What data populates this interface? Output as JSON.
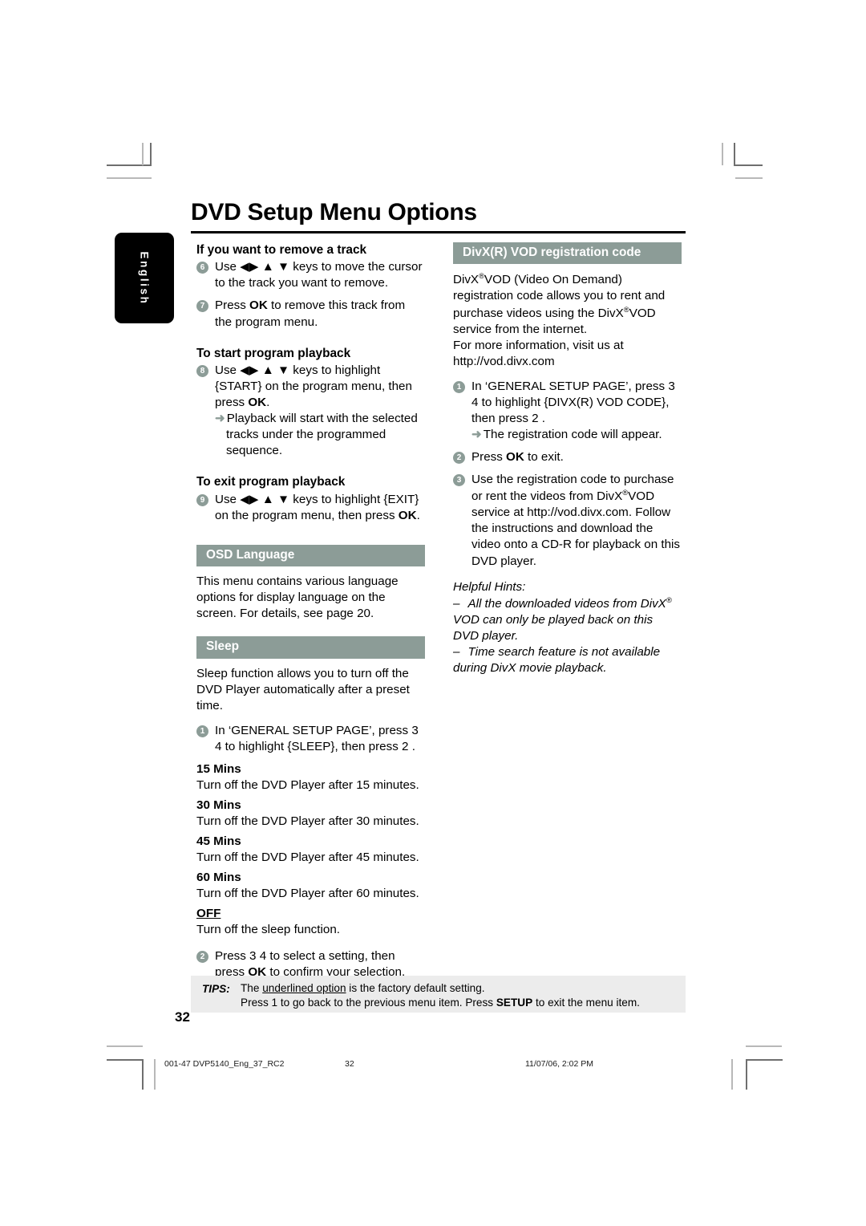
{
  "document": {
    "title": "DVD Setup Menu Options",
    "language_tab": "English",
    "page_number": "32"
  },
  "left_column": {
    "remove_track": {
      "heading": "If you want to remove a track",
      "steps": [
        {
          "num": "6",
          "text": "Use ◀▶ ▲ ▼ keys to move the cursor to the track you want to remove."
        },
        {
          "num": "7",
          "pre": "Press ",
          "key": "OK",
          "post": " to remove this track from the program menu."
        }
      ]
    },
    "start_playback": {
      "heading": "To start program playback",
      "step_num": "8",
      "text_pre": "Use ◀▶ ▲ ▼ keys to highlight {START} on the program menu, then press ",
      "key": "OK",
      "text_post": ".",
      "arrow_text": "Playback will start with the selected tracks under the programmed sequence."
    },
    "exit_playback": {
      "heading": "To exit program playback",
      "step_num": "9",
      "text_pre": "Use ◀▶ ▲ ▼ keys to highlight {EXIT} on the program menu, then press ",
      "key": "OK",
      "text_post": "."
    },
    "osd_language": {
      "bar_title": "OSD Language",
      "body": "This menu contains various language options for display language on the screen. For details, see page 20."
    },
    "sleep": {
      "bar_title": "Sleep",
      "body": "Sleep function allows you to turn off the DVD Player automatically after a preset time.",
      "step1": {
        "num": "1",
        "text": "In ‘GENERAL SETUP PAGE’, press 3  4  to highlight {SLEEP}, then press 2 ."
      },
      "options": [
        {
          "name": "15 Mins",
          "desc": "Turn off the DVD Player after 15 minutes.",
          "underlined": false
        },
        {
          "name": "30 Mins",
          "desc": "Turn off the DVD Player after 30 minutes.",
          "underlined": false
        },
        {
          "name": "45 Mins",
          "desc": "Turn off the DVD Player after 45 minutes.",
          "underlined": false
        },
        {
          "name": "60 Mins",
          "desc": "Turn off the DVD Player after 60 minutes.",
          "underlined": false
        },
        {
          "name": "OFF",
          "desc": "Turn off the sleep function.",
          "underlined": true
        }
      ],
      "step2": {
        "num": "2",
        "text_pre": "Press 3  4  to select a setting, then press ",
        "key": "OK",
        "text_post": " to confirm your selection."
      }
    }
  },
  "right_column": {
    "divx_vod": {
      "bar_title": "DivX(R) VOD registration code",
      "intro_line1_pre": "DivX",
      "intro_line1_sup": "®",
      "intro_line1_post": "VOD (Video On Demand) registration code allows you to rent and purchase videos using the DivX",
      "intro_line2_sup": "®",
      "intro_line2_post": "VOD service from the internet.",
      "intro_line3": "For more information, visit us at http://vod.divx.com",
      "steps": [
        {
          "num": "1",
          "text": "In ‘GENERAL SETUP PAGE’, press 3  4  to highlight {DIVX(R) VOD CODE}, then press 2 .",
          "arrow_text": "The registration code will appear."
        },
        {
          "num": "2",
          "text_pre": "Press ",
          "key": "OK",
          "text_post": " to exit."
        },
        {
          "num": "3",
          "text_pre": "Use the registration code to purchase or rent the videos from DivX",
          "sup": "®",
          "text_post": "VOD service at http://vod.divx.com. Follow the instructions and download the video onto a CD-R for playback on this DVD player."
        }
      ],
      "hints": {
        "title": "Helpful Hints:",
        "items": [
          {
            "dash": "–",
            "pre": "All the downloaded videos from DivX",
            "sup": "®",
            "post": " VOD can only be played back on this DVD player."
          },
          {
            "dash": "–",
            "pre": "Time search feature is not available during DivX movie playback.",
            "sup": "",
            "post": ""
          }
        ]
      }
    }
  },
  "tips": {
    "label": "TIPS:",
    "line1_pre": "The ",
    "line1_underlined": "underlined option",
    "line1_post": " is the factory default setting.",
    "line2_pre": "Press 1  to go back to the previous menu item. Press ",
    "line2_key": "SETUP",
    "line2_post": " to exit the menu item."
  },
  "footer_meta": {
    "file": "001-47 DVP5140_Eng_37_RC2",
    "page": "32",
    "date": "11/07/06, 2:02 PM"
  },
  "colors": {
    "accent_bar": "#8c9c97",
    "tips_bg": "#ececec",
    "tab_bg": "#000000"
  }
}
